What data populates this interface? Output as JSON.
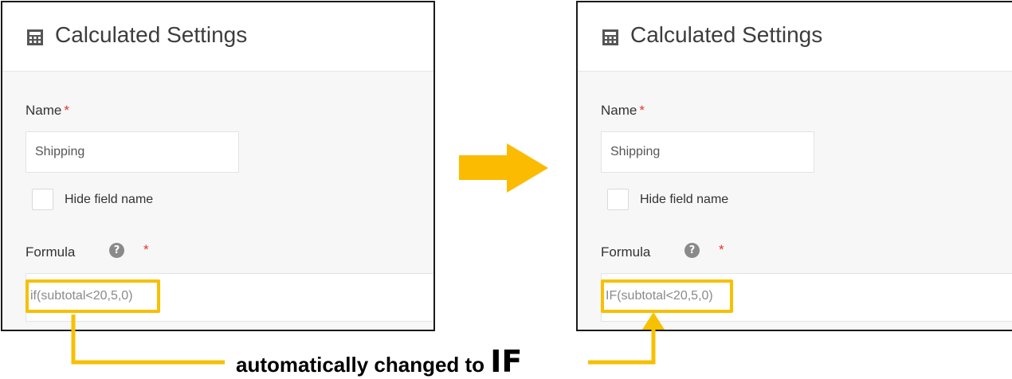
{
  "before": {
    "title": "Calculated Settings",
    "name_label": "Name",
    "required_mark": "*",
    "name_value": "Shipping",
    "hide_field_name_label": "Hide field name",
    "formula_label": "Formula",
    "help_glyph": "?",
    "formula_value": "if(subtotal<20,5,0)"
  },
  "after": {
    "title": "Calculated Settings",
    "name_label": "Name",
    "required_mark": "*",
    "name_value": "Shipping",
    "hide_field_name_label": "Hide field name",
    "formula_label": "Formula",
    "help_glyph": "?",
    "formula_value": "IF(subtotal<20,5,0)"
  },
  "annotation": {
    "caption_prefix": "automatically changed to ",
    "caption_emphasis": "IF"
  },
  "colors": {
    "highlight": "#f7c000",
    "required": "#e3342f",
    "arrow": "#fbbb00"
  },
  "icons": [
    "calculator-icon",
    "help-icon",
    "right-arrow-icon"
  ]
}
